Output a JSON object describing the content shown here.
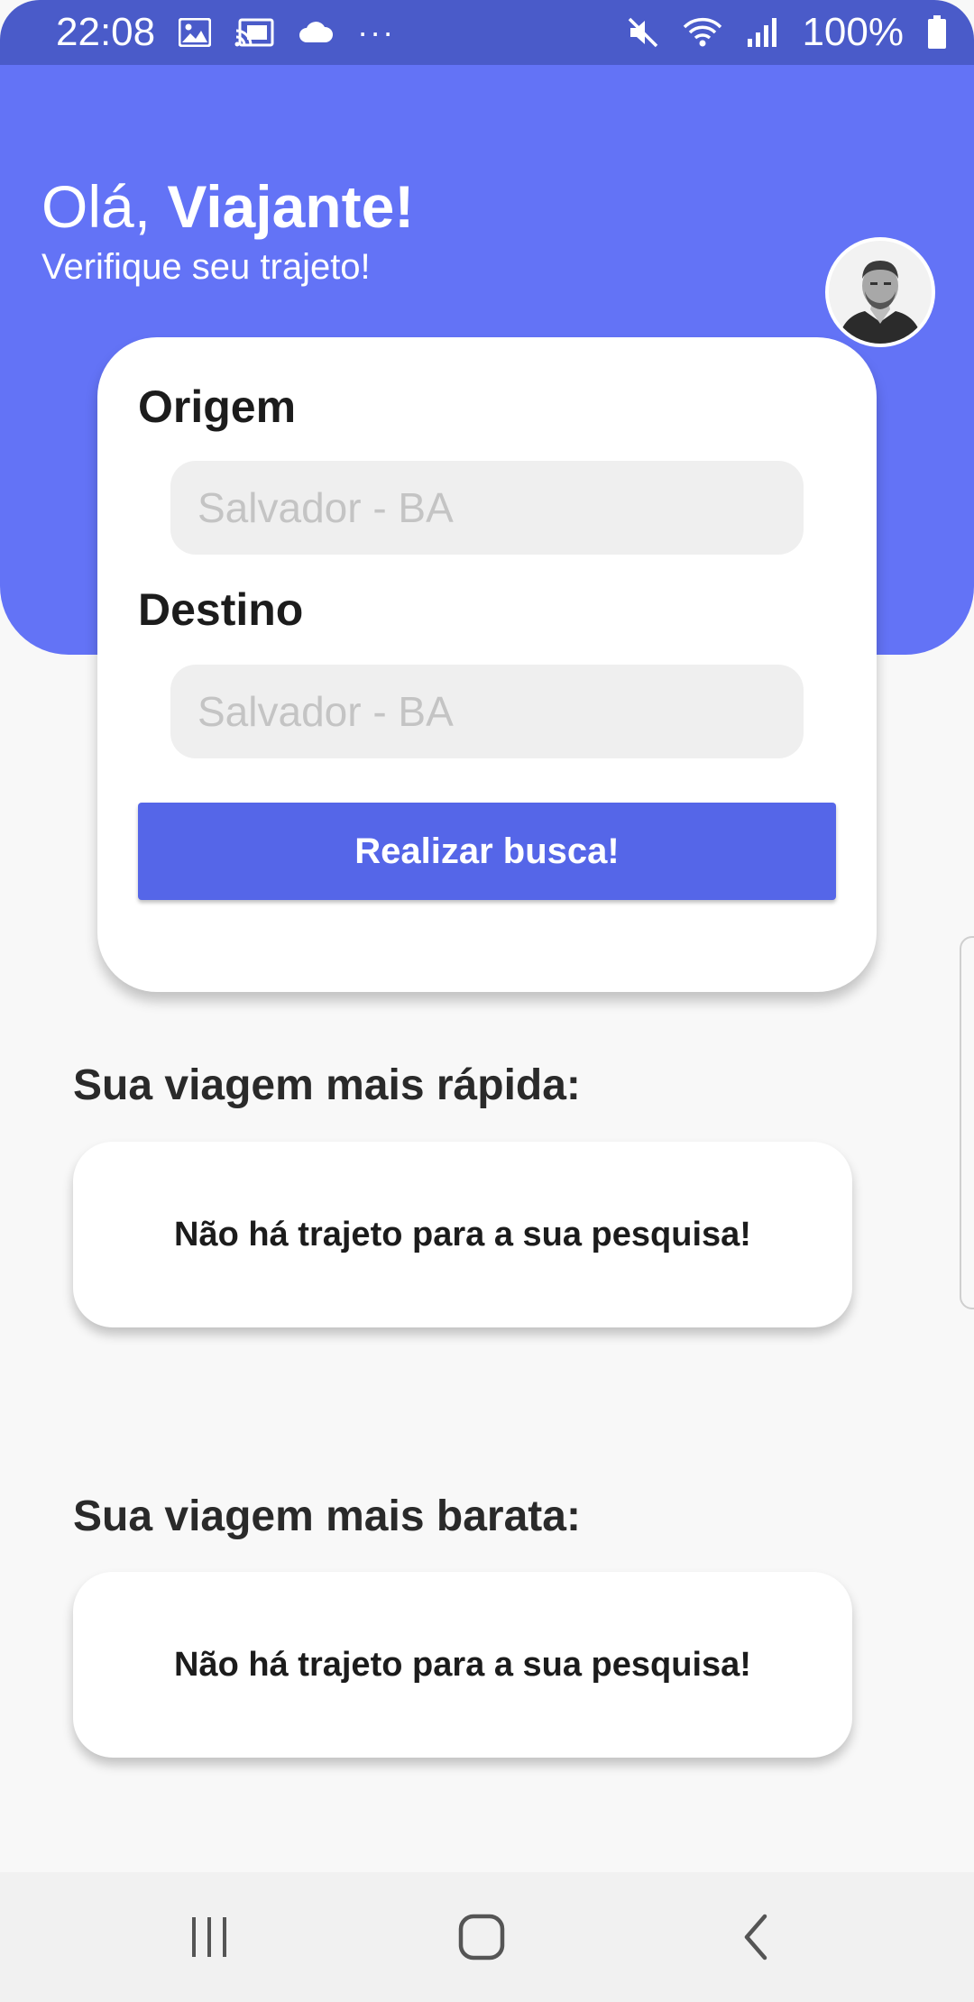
{
  "status_bar": {
    "time": "22:08",
    "battery": "100%",
    "more": "···",
    "icons": [
      "image-icon",
      "cast-icon",
      "cloud-icon",
      "mute-icon",
      "wifi-icon",
      "signal-icon",
      "battery-icon"
    ]
  },
  "header": {
    "greeting_prefix": "Olá, ",
    "greeting_name": "Viajante!",
    "subtitle": "Verifique seu trajeto!",
    "color": "#6373f6"
  },
  "form": {
    "origin_label": "Origem",
    "origin_placeholder": "Salvador - BA",
    "destination_label": "Destino",
    "destination_placeholder": "Salvador - BA",
    "search_button": "Realizar busca!"
  },
  "results": {
    "fastest_title": "Sua viagem mais rápida:",
    "fastest_message": "Não há trajeto para a sua pesquisa!",
    "cheapest_title": "Sua viagem mais barata:",
    "cheapest_message": "Não há trajeto para a sua pesquisa!"
  },
  "nav": {
    "icons": [
      "recent-apps-icon",
      "home-icon",
      "back-icon"
    ]
  }
}
